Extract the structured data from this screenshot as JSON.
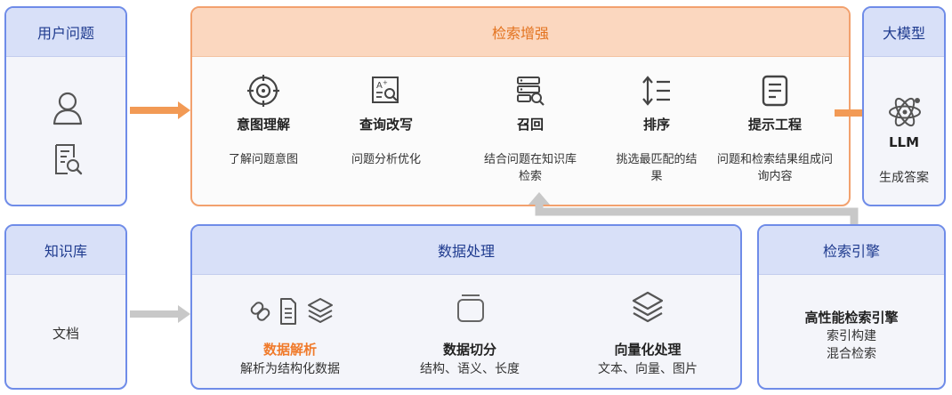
{
  "user": {
    "title": "用户问题"
  },
  "retrieval": {
    "title": "检索增强",
    "steps": [
      {
        "title": "意图理解",
        "desc": "了解问题意图"
      },
      {
        "title": "查询改写",
        "desc": "问题分析优化"
      },
      {
        "title": "召回",
        "desc": "结合问题在知识库检索"
      },
      {
        "title": "排序",
        "desc": "挑选最匹配的结果"
      },
      {
        "title": "提示工程",
        "desc": "问题和检索结果组成问询内容"
      }
    ]
  },
  "llm": {
    "title": "大模型",
    "name": "LLM",
    "desc": "生成答案"
  },
  "kb": {
    "title": "知识库",
    "doc": "文档"
  },
  "processing": {
    "title": "数据处理",
    "items": [
      {
        "title": "数据解析",
        "desc": "解析为结构化数据"
      },
      {
        "title": "数据切分",
        "desc": "结构、语义、长度"
      },
      {
        "title": "向量化处理",
        "desc": "文本、向量、图片"
      }
    ]
  },
  "engine": {
    "title": "检索引擎",
    "line1": "高性能检索引擎",
    "line2": "索引构建",
    "line3": "混合检索"
  },
  "colors": {
    "orange": "#f07a2a",
    "blue": "#6f8ce8",
    "arrow_gray": "#c8c8c8"
  }
}
